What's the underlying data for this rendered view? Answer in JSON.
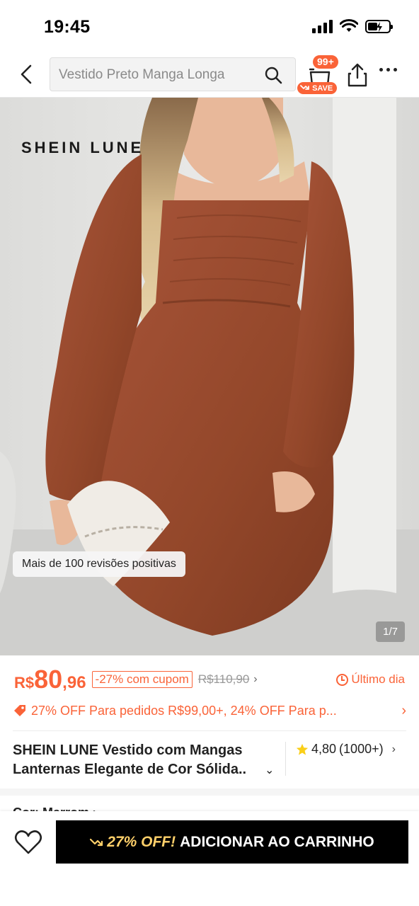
{
  "status_bar": {
    "time": "19:45"
  },
  "search": {
    "placeholder": "Vestido Preto Manga Longa"
  },
  "cart": {
    "badge": "99+",
    "save_label": "SAVE"
  },
  "product_image": {
    "brand_logo": "SHEIN LUNE",
    "review_chip": "Mais de 100 revisões positivas",
    "counter": "1/7"
  },
  "price": {
    "currency": "R$",
    "integer": "80",
    "decimal": ",96",
    "coupon_badge": "-27% com cupom",
    "original": "R$110,90",
    "last_day": "Último dia"
  },
  "promo": {
    "text": "27% OFF Para pedidos R$99,00+,  24% OFF Para p..."
  },
  "product": {
    "title_line1": "SHEIN LUNE Vestido com Mangas",
    "title_line2": "Lanternas Elegante de Cor Sólida..",
    "rating": "4,80",
    "rating_count": "(1000+)"
  },
  "color_section": {
    "label": "Cor: Marrom  ›"
  },
  "bottom_bar": {
    "off_label": "27% OFF!",
    "add_to_cart": "ADICIONAR AO CARRINHO"
  },
  "colors": {
    "accent": "#fa6338",
    "dress": "#9a4a2c",
    "button_bg": "#000000",
    "off_text": "#ffd06a"
  }
}
